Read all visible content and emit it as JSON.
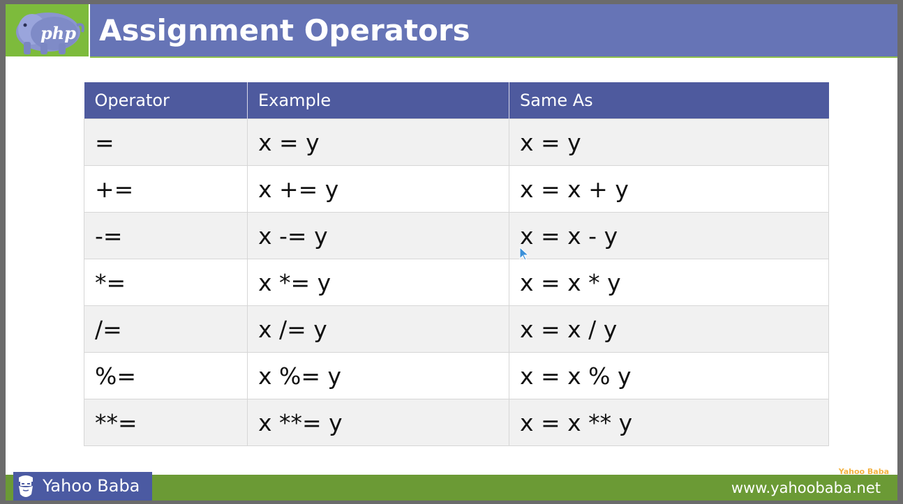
{
  "header": {
    "title": "Assignment Operators",
    "logo_text": "php"
  },
  "table": {
    "columns": [
      "Operator",
      "Example",
      "Same As"
    ],
    "rows": [
      [
        "=",
        "x = y",
        "x = y"
      ],
      [
        "+=",
        "x += y",
        "x = x + y"
      ],
      [
        "-=",
        "x -= y",
        "x = x - y"
      ],
      [
        "*=",
        "x *= y",
        "x = x * y"
      ],
      [
        "/=",
        "x /= y",
        "x = x / y"
      ],
      [
        "%=",
        "x %= y",
        "x = x % y"
      ],
      [
        "**=",
        "x **= y",
        "x = x ** y"
      ]
    ]
  },
  "footer": {
    "brand": "Yahoo Baba",
    "url": "www.yahoobaba.net",
    "watermark": "Yahoo Baba"
  },
  "colors": {
    "title_bar": "#6674b6",
    "logo_bg": "#7dbb3c",
    "table_header": "#4e5a9e",
    "footer_bg": "#6b9a35",
    "brand_bg": "#4b5aa2"
  }
}
